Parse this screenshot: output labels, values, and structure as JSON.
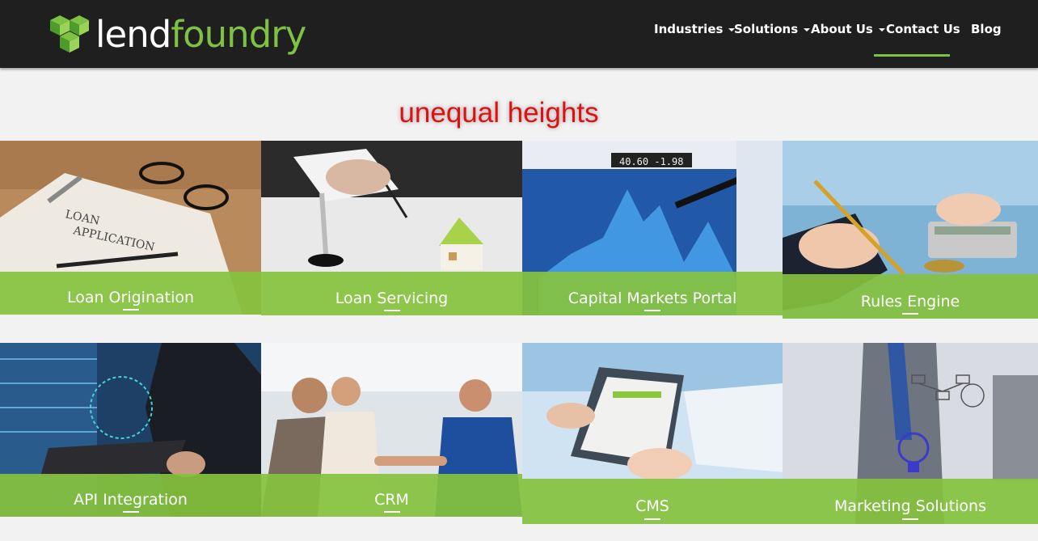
{
  "header": {
    "logo": {
      "part1": "lend",
      "part2": "foundry"
    },
    "nav": [
      {
        "label": "Industries",
        "dropdown": true
      },
      {
        "label": "Solutions",
        "dropdown": true
      },
      {
        "label": "About Us",
        "dropdown": true
      },
      {
        "label": "Contact Us",
        "dropdown": false,
        "active": true
      },
      {
        "label": "Blog",
        "dropdown": false
      }
    ],
    "accent_color": "#7dc242",
    "background_color": "#1f1f1f"
  },
  "annotation": {
    "text": "unequal heights",
    "color": "#e01010"
  },
  "tiles": [
    {
      "label": "Loan Origination"
    },
    {
      "label": "Loan Servicing"
    },
    {
      "label": "Capital Markets Portal"
    },
    {
      "label": "Rules Engine"
    },
    {
      "label": "API Integration"
    },
    {
      "label": "CRM"
    },
    {
      "label": "CMS"
    },
    {
      "label": "Marketing Solutions"
    }
  ],
  "caption_color": "#86c23e"
}
